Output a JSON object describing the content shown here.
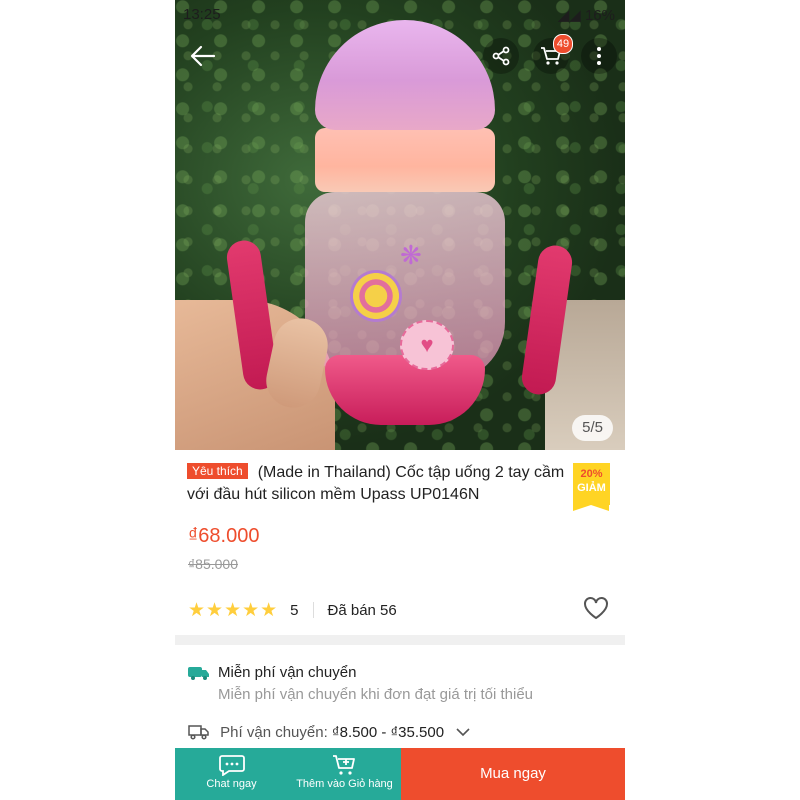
{
  "status_bar": {
    "time": "13:25",
    "battery": "16%"
  },
  "image_counter": "5/5",
  "cart": {
    "badge_count": "49"
  },
  "product": {
    "favorite_badge": "Yêu thích",
    "title": "(Made in Thailand) Cốc tập uống 2 tay cầm với đầu hút silicon mềm Upass UP0146N",
    "discount": {
      "percent": "20%",
      "label": "GIẢM"
    },
    "price": "₫68.000",
    "original_price": "₫85.000",
    "stars": "★★★★★",
    "rating": "5",
    "sold": "Đã bán 56"
  },
  "shipping": {
    "free_title": "Miễn phí vận chuyển",
    "free_sub": "Miễn phí vận chuyển khi đơn đạt giá trị tối thiểu",
    "fee_label": "Phí vận chuyển:",
    "fee_value": "₫8.500 - ₫35.500"
  },
  "bottom_bar": {
    "chat_label": "Chat ngay",
    "add_cart_label": "Thêm vào Giỏ hàng",
    "buy_label": "Mua ngay"
  },
  "colors": {
    "accent": "#ee4d2d",
    "teal": "#26aa99",
    "star": "#ffce3d"
  }
}
